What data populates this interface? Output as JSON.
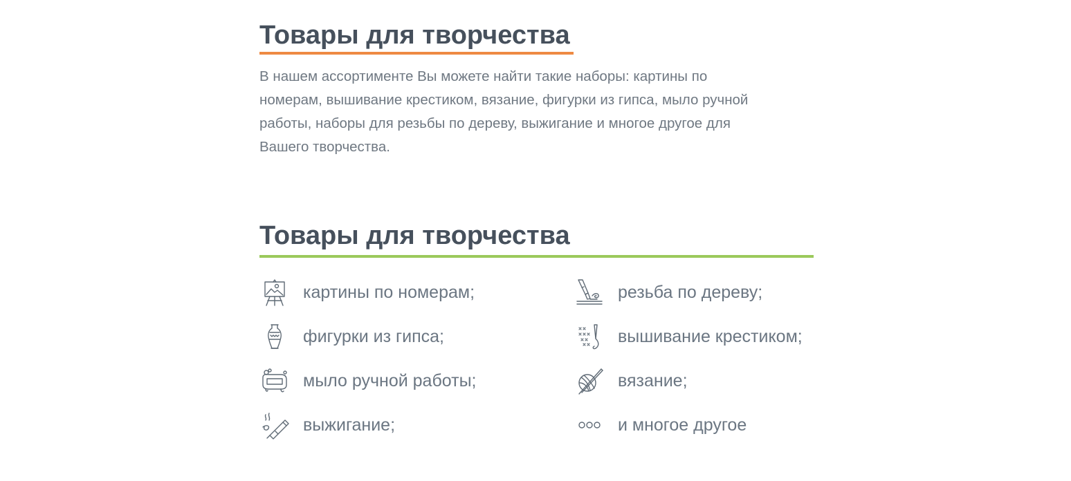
{
  "section1": {
    "title": "Товары для творчества",
    "text": "В нашем ассортименте Вы можете найти такие наборы: картины по номерам, вышивание крестиком, вязание, фигурки из гипса, мыло ручной работы, наборы для резьбы по дереву, выжигание и многое другое для Вашего творчества.",
    "accent_color": "#ee8a43"
  },
  "section2": {
    "title": "Товары для творчества",
    "accent_color": "#9bc95b",
    "features": [
      {
        "label": "картины по номерам;",
        "icon": "easel-painting-icon"
      },
      {
        "label": "резьба по дереву;",
        "icon": "wood-carving-knife-icon"
      },
      {
        "label": "фигурки из гипса;",
        "icon": "vase-figurine-icon"
      },
      {
        "label": "вышивание крестиком;",
        "icon": "cross-stitch-needle-icon"
      },
      {
        "label": "мыло ручной работы;",
        "icon": "soap-bar-icon"
      },
      {
        "label": "вязание;",
        "icon": "yarn-ball-knitting-icon"
      },
      {
        "label": "выжигание;",
        "icon": "wood-burning-pen-icon"
      },
      {
        "label": "и многое другое",
        "icon": "more-dots-icon"
      }
    ]
  }
}
